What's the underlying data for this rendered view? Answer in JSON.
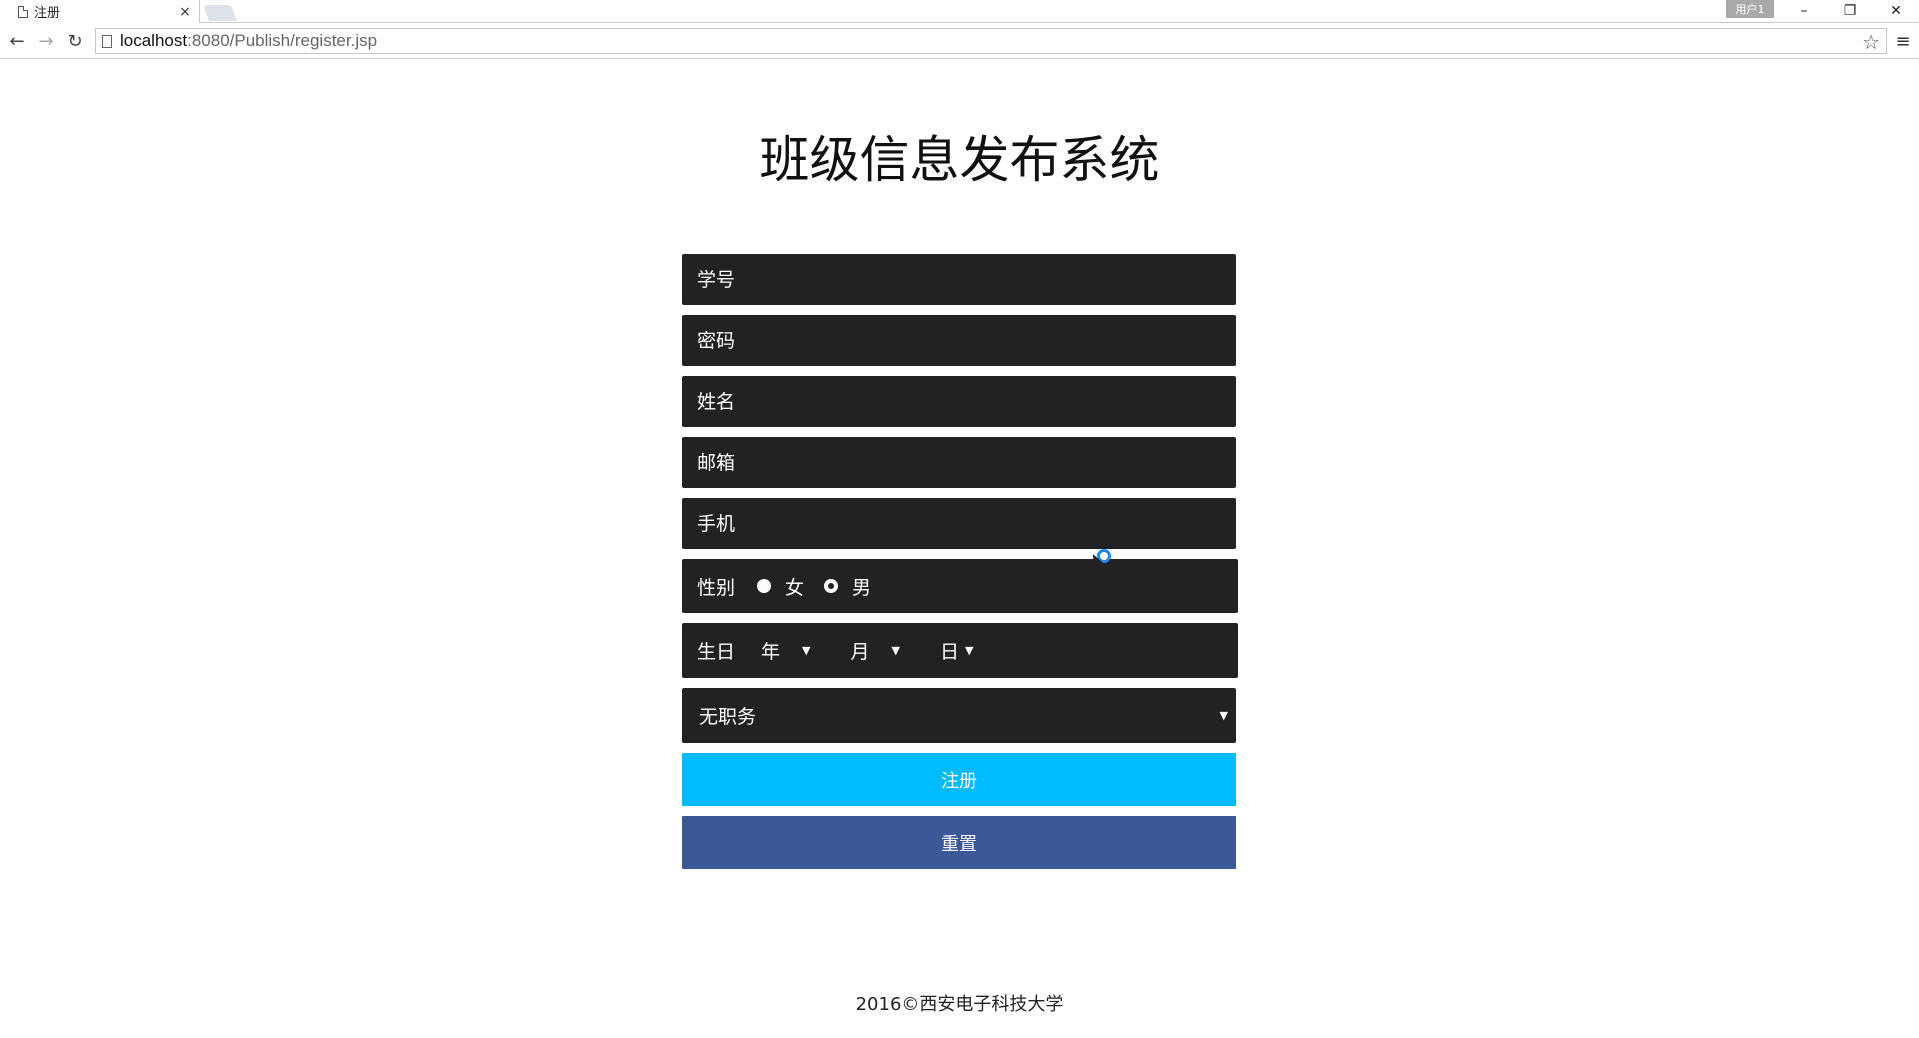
{
  "browser": {
    "tab_title": "注册",
    "tab_close": "×",
    "user_badge": "用户1",
    "controls": {
      "minimize": "–",
      "restore": "❐",
      "close": "✕"
    },
    "nav": {
      "back": "←",
      "forward": "→",
      "reload": "↻"
    },
    "url_host": "localhost",
    "url_path": ":8080/Publish/register.jsp",
    "bookmark_icon": "☆",
    "menu_icon": "≡"
  },
  "page": {
    "title": "班级信息发布系统"
  },
  "form": {
    "student_id": {
      "placeholder": "学号"
    },
    "password": {
      "placeholder": "密码"
    },
    "name": {
      "placeholder": "姓名"
    },
    "email": {
      "placeholder": "邮箱"
    },
    "phone": {
      "placeholder": "手机"
    },
    "gender": {
      "label": "性别",
      "options": [
        {
          "label": "女",
          "selected": false
        },
        {
          "label": "男",
          "selected": true
        }
      ]
    },
    "birthday": {
      "label": "生日",
      "year_label": "年",
      "month_label": "月",
      "day_label": "日",
      "arrow": "▼"
    },
    "role": {
      "selected": "无职务",
      "arrow": "▼"
    },
    "register_label": "注册",
    "reset_label": "重置"
  },
  "footer": {
    "text": "2016©西安电子科技大学"
  },
  "colors": {
    "field_bg": "#222224",
    "register_bg": "#00bbff",
    "reset_bg": "#3b5998"
  }
}
